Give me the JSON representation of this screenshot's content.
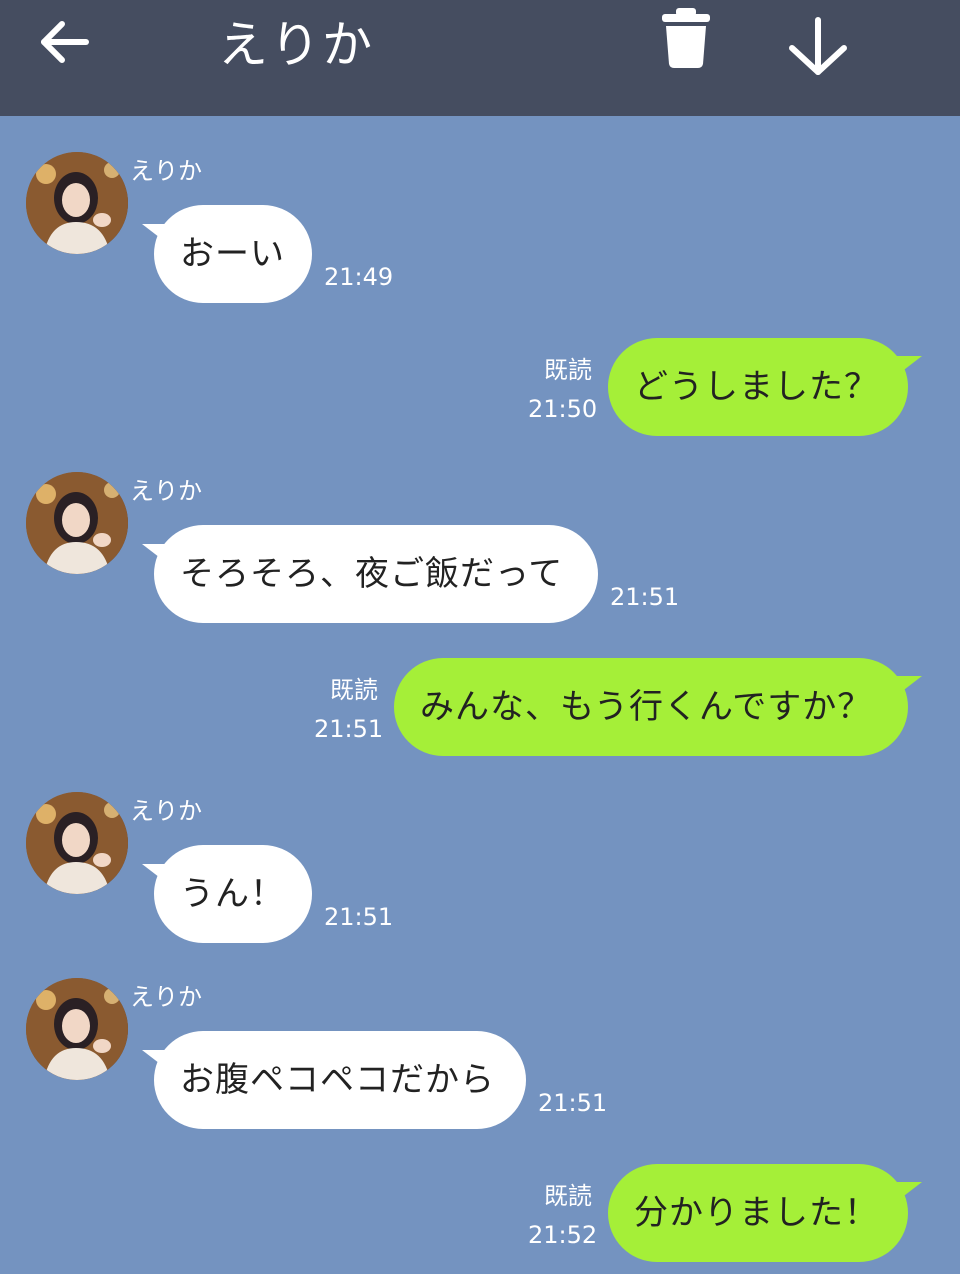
{
  "header": {
    "title": "えりか",
    "back_icon": "arrow-left-icon",
    "trash_icon": "trash-icon",
    "down_icon": "arrow-down-icon",
    "background": "#454d60"
  },
  "colors": {
    "chat_background": "#7493c0",
    "incoming_bubble": "#ffffff",
    "outgoing_bubble": "#a5ef38",
    "text": "#222222",
    "meta_text": "#ffffff"
  },
  "messages": [
    {
      "direction": "in",
      "sender": "えりか",
      "text": "おーい",
      "time": "21:49"
    },
    {
      "direction": "out",
      "read": "既読",
      "text": "どうしました？",
      "time": "21:50"
    },
    {
      "direction": "in",
      "sender": "えりか",
      "text": "そろそろ、夜ご飯だって",
      "time": "21:51"
    },
    {
      "direction": "out",
      "read": "既読",
      "text": "みんな、もう行くんですか？",
      "time": "21:51"
    },
    {
      "direction": "in",
      "sender": "えりか",
      "text": "うん！",
      "time": "21:51"
    },
    {
      "direction": "in",
      "sender": "えりか",
      "text": "お腹ペコペコだから",
      "time": "21:51"
    },
    {
      "direction": "out",
      "read": "既読",
      "text": "分かりました！",
      "time": "21:52"
    }
  ]
}
